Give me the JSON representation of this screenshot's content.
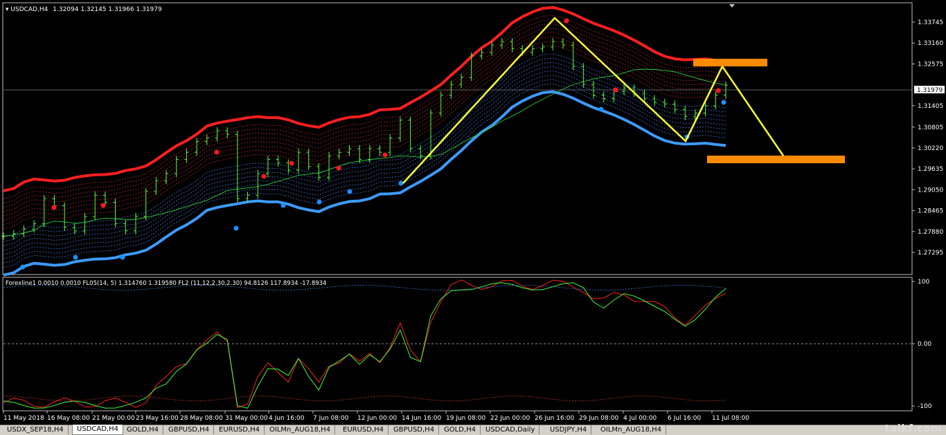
{
  "main_chart": {
    "symbol_label": "USDCAD,H4",
    "ohlc_label": "1.32094 1.32145 1.31966 1.31979",
    "current_price": "1.31979",
    "price_ticks": [
      "1.33745",
      "1.33160",
      "1.32575",
      "1.31405",
      "1.30805",
      "1.30220",
      "1.29635",
      "1.29050",
      "1.28465",
      "1.27880",
      "1.27295"
    ]
  },
  "indicator": {
    "label": "Forexline1 0.0010 0.0010  FL05(14, 5) 1.314760 1.319580  FL2 (11,12,2.30,2.30) 94.8126 117.8934 -17.8934",
    "ticks": [
      "100",
      "0.00",
      "-100"
    ]
  },
  "time_axis": [
    "11 May 2018",
    "16 May 08:00",
    "21 May 00:00",
    "23 May 16:00",
    "28 May 08:00",
    "31 May 00:00",
    "4 Jun 16:00",
    "7 Jun 08:00",
    "12 Jun 00:00",
    "14 Jun 16:00",
    "19 Jun 08:00",
    "22 Jun 00:00",
    "26 Jun 16:00",
    "29 Jun 08:00",
    "4 Jul 00:00",
    "6 Jul 16:00",
    "11 Jul 08:00"
  ],
  "tabs": [
    "USDX_SEP18,H4",
    "USDCAD,H4",
    "GOLD,H4",
    "GBPUSD,H4",
    "EURUSD,H4",
    "OILMn_AUG18,H4",
    "EURUSD,H4",
    "GBPUSD,H4",
    "GOLD,H4",
    "USDCAD,Daily",
    "USDJPY,H4",
    "OILMn_AUG18,H4"
  ],
  "active_tab": "USDCAD,H4",
  "watermark": "taikf.com",
  "chart_data": {
    "type": "line",
    "title": "USDCAD,H4",
    "ylim": [
      1.27,
      1.34
    ],
    "close_series": [
      1.2775,
      1.2782,
      1.2795,
      1.281,
      1.288,
      1.286,
      1.28,
      1.279,
      1.283,
      1.289,
      1.287,
      1.281,
      1.279,
      1.283,
      1.29,
      1.293,
      1.295,
      1.299,
      1.301,
      1.304,
      1.305,
      1.307,
      1.306,
      1.288,
      1.289,
      1.295,
      1.299,
      1.298,
      1.296,
      1.301,
      1.297,
      1.294,
      1.3,
      1.301,
      1.302,
      1.299,
      1.302,
      1.301,
      1.305,
      1.31,
      1.302,
      1.3,
      1.312,
      1.317,
      1.32,
      1.322,
      1.328,
      1.329,
      1.331,
      1.332,
      1.33,
      1.329,
      1.33,
      1.3305,
      1.332,
      1.331,
      1.325,
      1.32,
      1.317,
      1.316,
      1.318,
      1.319,
      1.3175,
      1.316,
      1.315,
      1.3145,
      1.313,
      1.311,
      1.312,
      1.314,
      1.317,
      1.3198
    ],
    "zigzag": [
      [
        1.2962,
        0
      ],
      [
        1.338,
        1
      ],
      [
        1.307,
        2
      ],
      [
        1.326,
        3
      ],
      [
        1.3024,
        4
      ]
    ],
    "target_zones": [
      "1.3267",
      "1.3024"
    ]
  }
}
